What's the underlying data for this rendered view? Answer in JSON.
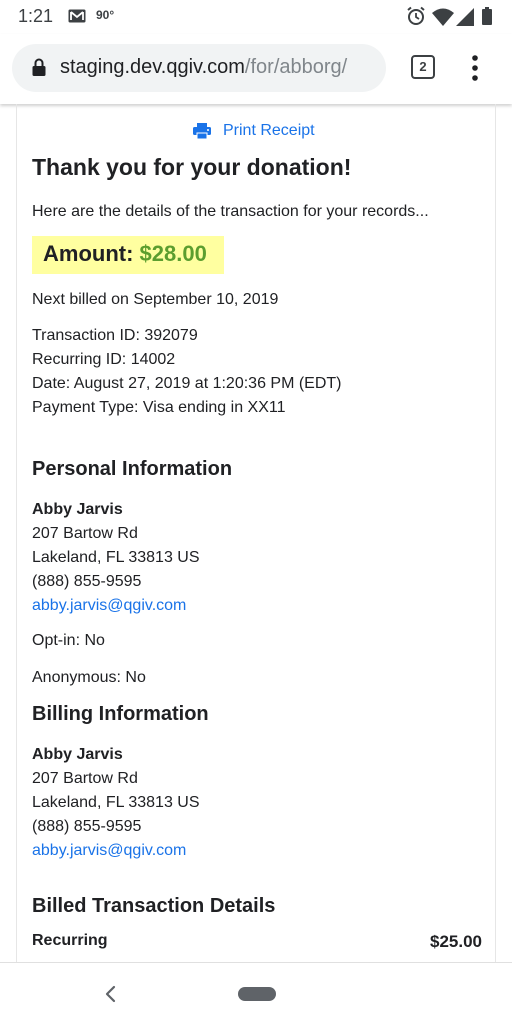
{
  "status_bar": {
    "time": "1:21",
    "temperature": "90°",
    "icons": [
      "mail-icon",
      "alarm-icon",
      "wifi-icon",
      "signal-icon",
      "battery-icon"
    ]
  },
  "browser": {
    "url_host": "staging.dev.qgiv.com",
    "url_path": "/for/abborg/",
    "tab_count": "2",
    "icons": [
      "lock-icon",
      "tabs-icon",
      "more-vert-icon"
    ]
  },
  "receipt": {
    "print_label": "Print Receipt",
    "title": "Thank you for your donation!",
    "intro": "Here are the details of the transaction for your records...",
    "amount_label": "Amount:",
    "amount_value": "$28.00",
    "next_billed": "Next billed on September 10, 2019",
    "transaction_id": "Transaction ID: 392079",
    "recurring_id": "Recurring ID: 14002",
    "date": "Date: August 27, 2019 at 1:20:36 PM (EDT)",
    "payment_type": "Payment Type: Visa ending in XX11"
  },
  "personal": {
    "heading": "Personal Information",
    "name": "Abby Jarvis",
    "street": "207 Bartow Rd",
    "city_line": "Lakeland, FL 33813 US",
    "phone": "(888) 855-9595",
    "email": "abby.jarvis@qgiv.com",
    "opt_in": "Opt-in: No",
    "anonymous": "Anonymous: No"
  },
  "billing": {
    "heading": "Billing Information",
    "name": "Abby Jarvis",
    "street": "207 Bartow Rd",
    "city_line": "Lakeland, FL 33813 US",
    "phone": "(888) 855-9595",
    "email": "abby.jarvis@qgiv.com"
  },
  "billed_transaction": {
    "heading": "Billed Transaction Details",
    "row_label": "Recurring",
    "row_value": "$25.00"
  },
  "colors": {
    "link": "#1a73e8",
    "amount_highlight": "#ffffa0",
    "amount_value": "#5c9e2f"
  }
}
